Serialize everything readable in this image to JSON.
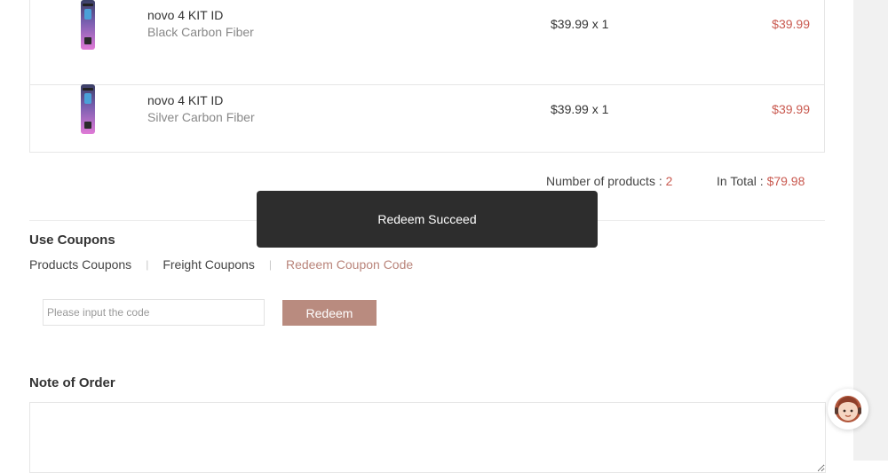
{
  "cart": {
    "items": [
      {
        "name": "novo 4 KIT ID",
        "variant": "Black Carbon Fiber",
        "qty_price": "$39.99 x 1",
        "total": "$39.99"
      },
      {
        "name": "novo 4 KIT ID",
        "variant": "Silver Carbon Fiber",
        "qty_price": "$39.99 x 1",
        "total": "$39.99"
      }
    ],
    "summary": {
      "count_label": "Number of products : ",
      "count_value": "2",
      "total_label": "In Total : ",
      "total_value": "$79.98"
    }
  },
  "coupons": {
    "title": "Use Coupons",
    "tabs": [
      {
        "label": "Products Coupons"
      },
      {
        "label": "Freight Coupons"
      },
      {
        "label": "Redeem Coupon Code"
      }
    ],
    "separator": "|",
    "input_placeholder": "Please input the code",
    "redeem_label": "Redeem"
  },
  "note": {
    "title": "Note of Order"
  },
  "toast": {
    "message": "Redeem Succeed"
  },
  "colors": {
    "accent": "#b98b7f",
    "price": "#c9594f",
    "toast_bg": "#2d2d2d"
  },
  "icons": {
    "product": "vape-pod-icon",
    "support": "customer-service-icon"
  }
}
